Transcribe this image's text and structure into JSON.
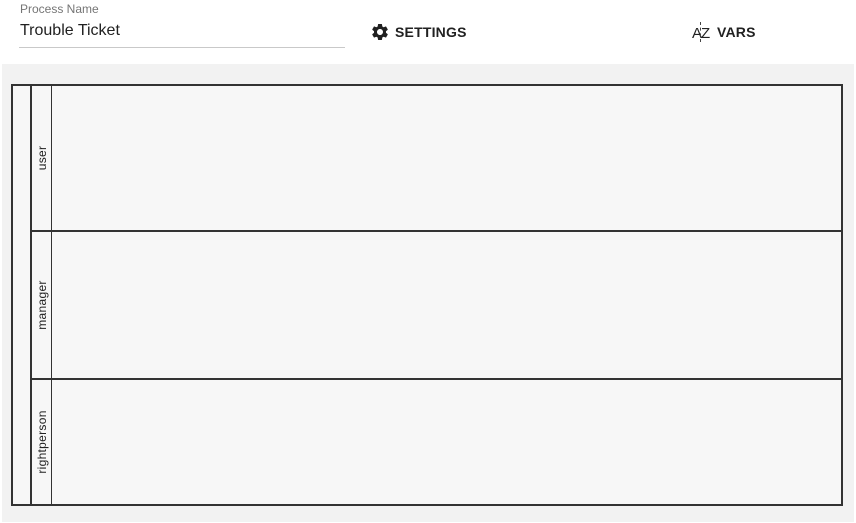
{
  "toolbar": {
    "process_name_label": "Process Name",
    "process_name_value": "Trouble Ticket",
    "settings_label": "SETTINGS",
    "settings_icon": "gear-icon",
    "vars_label": "VARS",
    "vars_icon": "sort-az-icon",
    "vars_icon_letters": {
      "a": "A",
      "z": "Z"
    }
  },
  "diagram": {
    "lanes": [
      {
        "label": "user"
      },
      {
        "label": "manager"
      },
      {
        "label": "rightperson"
      }
    ]
  },
  "colors": {
    "canvas_background": "#f2f2f2",
    "lane_background": "#f7f7f7",
    "border": "#333333",
    "text": "#212121",
    "label_muted": "#757575"
  }
}
